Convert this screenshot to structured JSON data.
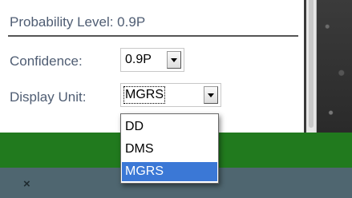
{
  "panel": {
    "title": "Probability Level: 0.9P"
  },
  "confidence": {
    "label": "Confidence:",
    "value": "0.9P"
  },
  "display_unit": {
    "label": "Display Unit:",
    "value": "MGRS",
    "options": [
      "DD",
      "DMS",
      "MGRS"
    ],
    "selected_option": "MGRS"
  },
  "bottom_bar": {
    "close_glyph": "×"
  },
  "colors": {
    "label_text": "#4f5d73",
    "status_bar": "#217a1e",
    "bottom_bar": "#4f6670",
    "selection_highlight": "#3b78d6"
  }
}
